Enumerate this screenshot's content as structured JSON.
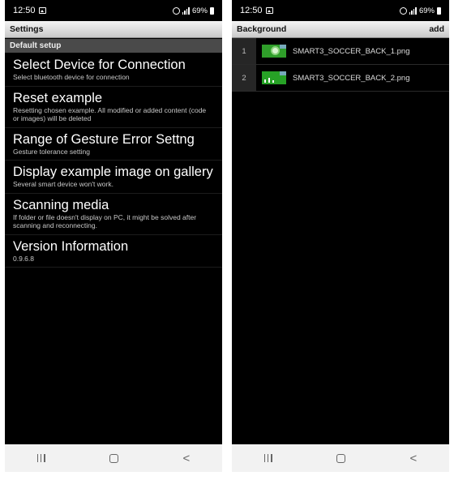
{
  "left_screen": {
    "status": {
      "time": "12:50",
      "battery": "69%"
    },
    "title": "Settings",
    "section": "Default setup",
    "items": [
      {
        "title": "Select Device for Connection",
        "subtitle": "Select bluetooth device for connection"
      },
      {
        "title": "Reset example",
        "subtitle": "Resetting chosen example. All modified or added content (code or images) will be deleted"
      },
      {
        "title": "Range of Gesture Error Settng",
        "subtitle": "Gesture tolerance setting"
      },
      {
        "title": "Display example image on gallery",
        "subtitle": "Several smart device won't work."
      },
      {
        "title": "Scanning media",
        "subtitle": "If folder or file doesn't display on PC, it might be solved after scanning and reconnecting."
      },
      {
        "title": "Version Information",
        "subtitle": "0.9.6.8"
      }
    ],
    "nav": {
      "recent_icon": "recent-apps-icon",
      "home_icon": "home-icon",
      "back_icon": "back-icon",
      "back_glyph": "<"
    }
  },
  "right_screen": {
    "status": {
      "time": "12:50",
      "battery": "69%"
    },
    "title": "Background",
    "add_label": "add",
    "items": [
      {
        "index": "1",
        "name": "SMART3_SOCCER_BACK_1.png"
      },
      {
        "index": "2",
        "name": "SMART3_SOCCER_BACK_2.png"
      }
    ],
    "nav": {
      "recent_icon": "recent-apps-icon",
      "home_icon": "home-icon",
      "back_icon": "back-icon",
      "back_glyph": "<"
    }
  }
}
